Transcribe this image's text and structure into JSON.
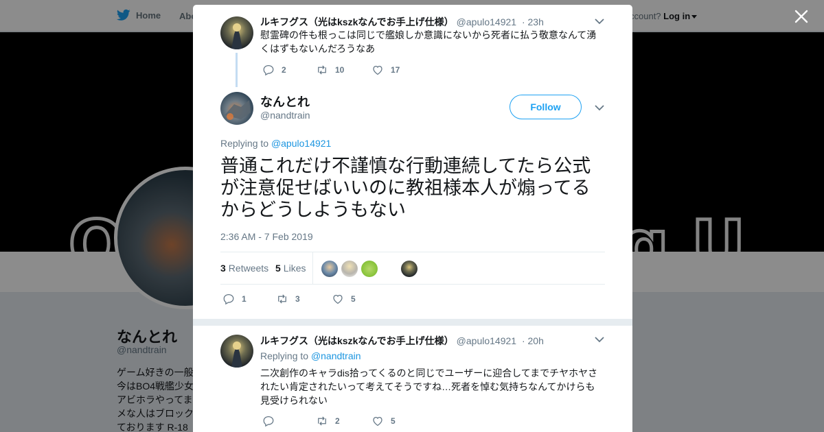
{
  "nav": {
    "home_label": "Home",
    "about_label": "Abo",
    "login_prefix": "ccount?",
    "login_label": "Log in"
  },
  "banner": {
    "visible_text_left": "Q",
    "visible_text_right": "g U"
  },
  "bg_profile": {
    "name": "なんとれ",
    "handle": "@nandtrain",
    "bio_lines": [
      "ゲーム好きの一般",
      "今はBO4戦艦少女",
      "アビホラやってま",
      "メな人はブロック",
      "ております R-18"
    ]
  },
  "tweets": [
    {
      "name": "ルキフグス（光はkszkなんでお手上げ仕様）",
      "handle": "@apulo14921",
      "time": "· 23h",
      "text": "慰霊碑の件も根っこは同じで艦娘しか意識にないから死者に払う敬意なんて湧くはずもないんだろうなあ",
      "replies": "2",
      "retweets": "10",
      "likes": "17"
    }
  ],
  "main_tweet": {
    "name": "なんとれ",
    "handle": "@nandtrain",
    "follow_label": "Follow",
    "replying_prefix": "Replying to",
    "replying_to": "@apulo14921",
    "text": "普通これだけ不謹慎な行動連続してたら公式が注意促せばいいのに教祖様本人が煽ってるからどうしようもない",
    "timestamp": "2:36 AM - 7 Feb 2019",
    "retweet_count": "3",
    "retweet_label": "Retweets",
    "like_count": "5",
    "like_label": "Likes",
    "replies": "1",
    "retweets": "3",
    "likes": "5"
  },
  "reply_tweet": {
    "name": "ルキフグス（光はkszkなんでお手上げ仕様）",
    "handle": "@apulo14921",
    "time": "· 20h",
    "replying_prefix": "Replying to",
    "replying_to": "@nandtrain",
    "text": "二次創作のキャラdis拾ってくるのと同じでユーザーに迎合してまでチヤホヤされたい肯定されたいって考えてそうですね…死者を悼む気持ちなんてかけらも見受けられない",
    "replies": "",
    "retweets": "2",
    "likes": "5"
  },
  "colors": {
    "accent": "#1da1f2",
    "link": "#1b95e0",
    "muted": "#657786",
    "text": "#14171a"
  }
}
